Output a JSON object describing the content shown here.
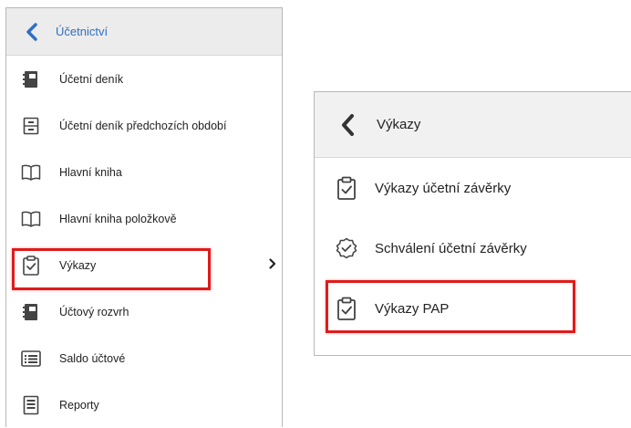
{
  "left_panel": {
    "back_label": "Účetnictví",
    "items": [
      {
        "label": "Účetní deník",
        "icon": "journal-icon"
      },
      {
        "label": "Účetní deník předchozích období",
        "icon": "cabinet-icon"
      },
      {
        "label": "Hlavní kniha",
        "icon": "book-icon"
      },
      {
        "label": "Hlavní kniha položkově",
        "icon": "book-icon"
      },
      {
        "label": "Výkazy",
        "icon": "clipboard-check-icon",
        "has_submenu": true,
        "highlighted": true
      },
      {
        "label": "Účtový rozvrh",
        "icon": "journal-icon"
      },
      {
        "label": "Saldo účtové",
        "icon": "list-icon"
      },
      {
        "label": "Reporty",
        "icon": "report-icon"
      }
    ]
  },
  "right_panel": {
    "back_label": "Výkazy",
    "items": [
      {
        "label": "Výkazy účetní závěrky",
        "icon": "clipboard-check-icon"
      },
      {
        "label": "Schválení účetní závěrky",
        "icon": "badge-check-icon"
      },
      {
        "label": "Výkazy PAP",
        "icon": "clipboard-check-icon",
        "highlighted": true
      }
    ]
  },
  "colors": {
    "accent": "#2f6fc4",
    "highlight": "#e01b1b",
    "header_bg": "#ececec"
  }
}
